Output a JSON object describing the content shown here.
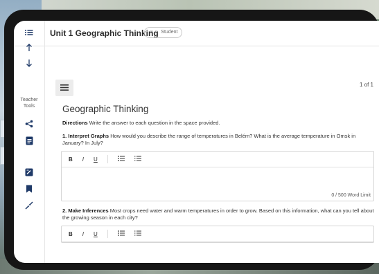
{
  "header": {
    "title": "Unit 1 Geographic Thinking",
    "badge": "Student"
  },
  "rail": {
    "teacher_tools": "Teacher Tools"
  },
  "pager": "1 of 1",
  "page": {
    "heading": "Geographic Thinking",
    "directions_label": "Directions",
    "directions_text": "Write the answer to each question in the space provided.",
    "questions": [
      {
        "label": "1. Interpret Graphs",
        "text": "How would you describe the range of temperatures in Belém? What is the average temperature in Omsk in January? In July?",
        "word_limit": "0 / 500 Word Limit"
      },
      {
        "label": "2. Make Inferences",
        "text": "Most crops need water and warm temperatures in order to grow. Based on this information, what can you tell about the growing season in each city?"
      }
    ]
  },
  "toolbar": {
    "bold": "B",
    "italic": "I",
    "underline": "U"
  },
  "icons": [
    "list-icon",
    "arrow-up-icon",
    "arrow-down-icon",
    "share-icon",
    "notes-icon",
    "edit-note-icon",
    "bookmark-icon",
    "collapse-icon",
    "hamburger-icon"
  ]
}
